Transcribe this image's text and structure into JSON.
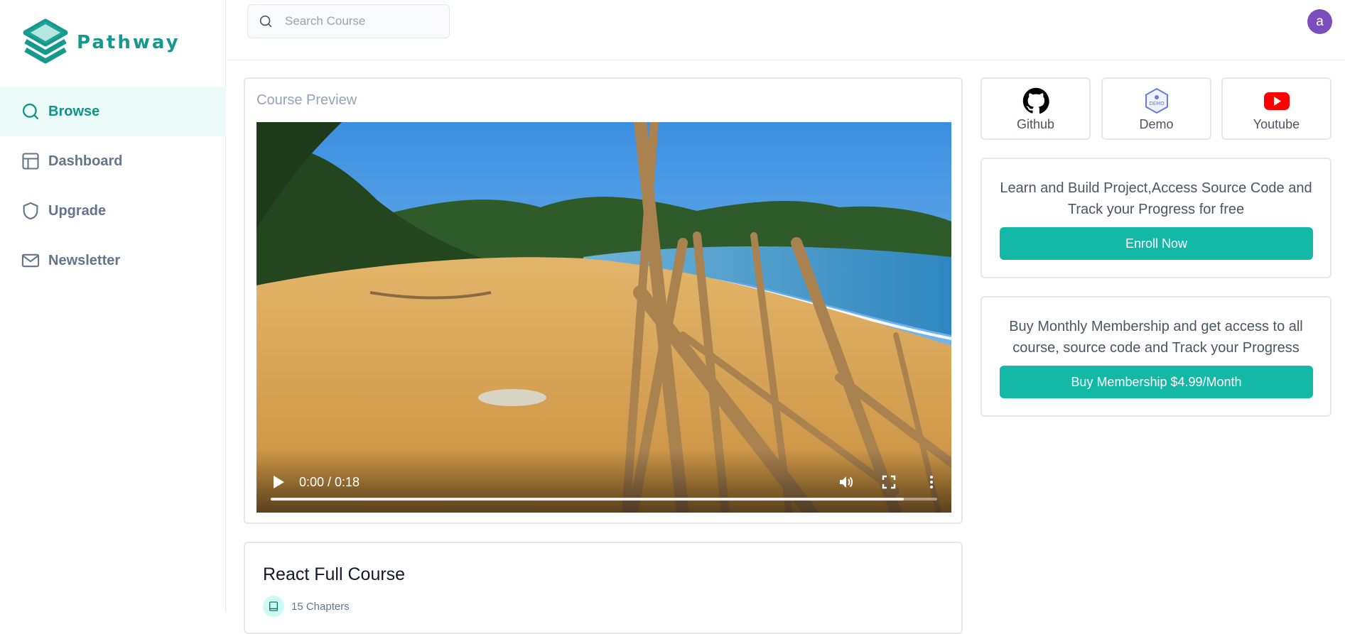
{
  "app": {
    "logo_text": "Pathway",
    "logo_icon": "pathway-logo-icon",
    "accent_color": "#14b8a6"
  },
  "sidebar": {
    "items": [
      {
        "label": "Browse",
        "icon": "search-icon",
        "active": true
      },
      {
        "label": "Dashboard",
        "icon": "layout-icon",
        "active": false
      },
      {
        "label": "Upgrade",
        "icon": "shield-icon",
        "active": false
      },
      {
        "label": "Newsletter",
        "icon": "mail-icon",
        "active": false
      }
    ]
  },
  "header": {
    "search_placeholder": "Search Course",
    "avatar_initial": "a",
    "avatar_color": "#7c4dbc"
  },
  "preview": {
    "title": "Course Preview",
    "video": {
      "time": "0:00 / 0:18",
      "progress_buffered": 0.95
    }
  },
  "course": {
    "title": "React Full Course",
    "chapters": "15 Chapters"
  },
  "links": [
    {
      "label": "Github",
      "icon": "github-icon"
    },
    {
      "label": "Demo",
      "icon": "demo-badge-icon"
    },
    {
      "label": "Youtube",
      "icon": "youtube-icon"
    }
  ],
  "enroll": {
    "text": "Learn and Build Project,Access Source Code and Track your Progress for free",
    "button": "Enroll Now"
  },
  "membership": {
    "text": "Buy Monthly Membership and get access to all course, source code and Track your Progress",
    "button": "Buy Membership $4.99/Month"
  }
}
